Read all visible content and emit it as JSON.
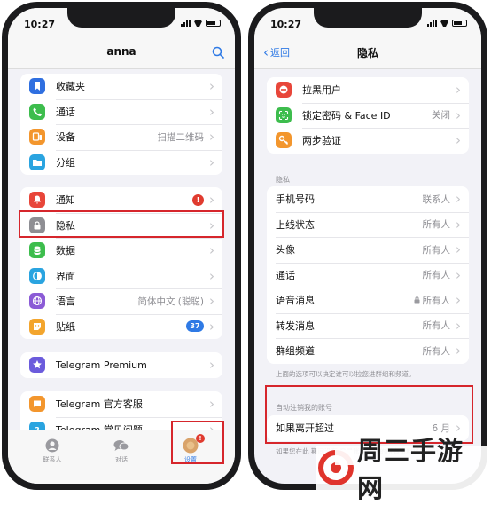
{
  "left": {
    "time": "10:27",
    "title": "anna",
    "group1": [
      {
        "label": "收藏夹",
        "value": "",
        "icon": "bookmark-icon",
        "color": "#2f6fe0"
      },
      {
        "label": "通话",
        "value": "",
        "icon": "phone-icon",
        "color": "#3dbd4d"
      },
      {
        "label": "设备",
        "value": "扫描二维码",
        "icon": "devices-icon",
        "color": "#f3962d"
      },
      {
        "label": "分组",
        "value": "",
        "icon": "folder-icon",
        "color": "#2aa4e0"
      }
    ],
    "group2": [
      {
        "label": "通知",
        "value": "",
        "badge": "!",
        "icon": "bell-icon",
        "color": "#e8463a"
      },
      {
        "label": "隐私",
        "value": "",
        "icon": "lock-icon",
        "color": "#8e8e93"
      },
      {
        "label": "数据",
        "value": "",
        "icon": "database-icon",
        "color": "#3dbd4d"
      },
      {
        "label": "界面",
        "value": "",
        "icon": "appearance-icon",
        "color": "#2aa4e0"
      },
      {
        "label": "语言",
        "value": "简体中文 (聪聪)",
        "icon": "globe-icon",
        "color": "#8b5bd6"
      },
      {
        "label": "贴纸",
        "value": "",
        "badge": "37",
        "icon": "sticker-icon",
        "color": "#f3a52d"
      }
    ],
    "group3": [
      {
        "label": "Telegram Premium",
        "icon": "star-icon",
        "color": "#6b5bdc"
      }
    ],
    "group4": [
      {
        "label": "Telegram 官方客服",
        "icon": "chat-icon",
        "color": "#f3962d"
      },
      {
        "label": "Telegram 常见问题",
        "icon": "question-icon",
        "color": "#2aa4e0"
      }
    ],
    "tabs": [
      {
        "label": "联系人",
        "icon": "person-icon"
      },
      {
        "label": "对话",
        "icon": "chat-bubbles-icon"
      },
      {
        "label": "设置",
        "icon": "settings-avatar-icon",
        "badge": "!"
      }
    ]
  },
  "right": {
    "time": "10:27",
    "back_label": "返回",
    "title": "隐私",
    "group1": [
      {
        "label": "拉黑用户",
        "value": "",
        "icon": "blocked-icon",
        "color": "#e8463a"
      },
      {
        "label": "锁定密码 & Face ID",
        "value": "关闭",
        "icon": "faceid-icon",
        "color": "#3dbd4d"
      },
      {
        "label": "两步验证",
        "value": "",
        "icon": "key-icon",
        "color": "#f3962d"
      }
    ],
    "section_header": "隐私",
    "privacy_rows": [
      {
        "label": "手机号码",
        "value": "联系人"
      },
      {
        "label": "上线状态",
        "value": "所有人"
      },
      {
        "label": "头像",
        "value": "所有人"
      },
      {
        "label": "通话",
        "value": "所有人"
      },
      {
        "label": "语音消息",
        "value": "所有人",
        "locked": true
      },
      {
        "label": "转发消息",
        "value": "所有人"
      },
      {
        "label": "群组频道",
        "value": "所有人"
      }
    ],
    "privacy_footer": "上面的选项可以决定谁可以拉您进群组和频道。",
    "auto_header": "自动注销我的账号",
    "auto_row": {
      "label": "如果离开超过",
      "value": "6 月"
    },
    "auto_footer": "如果您在此 期间没有 登录账号，您的所有资料将被删除。"
  },
  "watermark": "周三手游网",
  "colors": {
    "accent": "#2f7ae5",
    "highlight": "#d6262c"
  }
}
